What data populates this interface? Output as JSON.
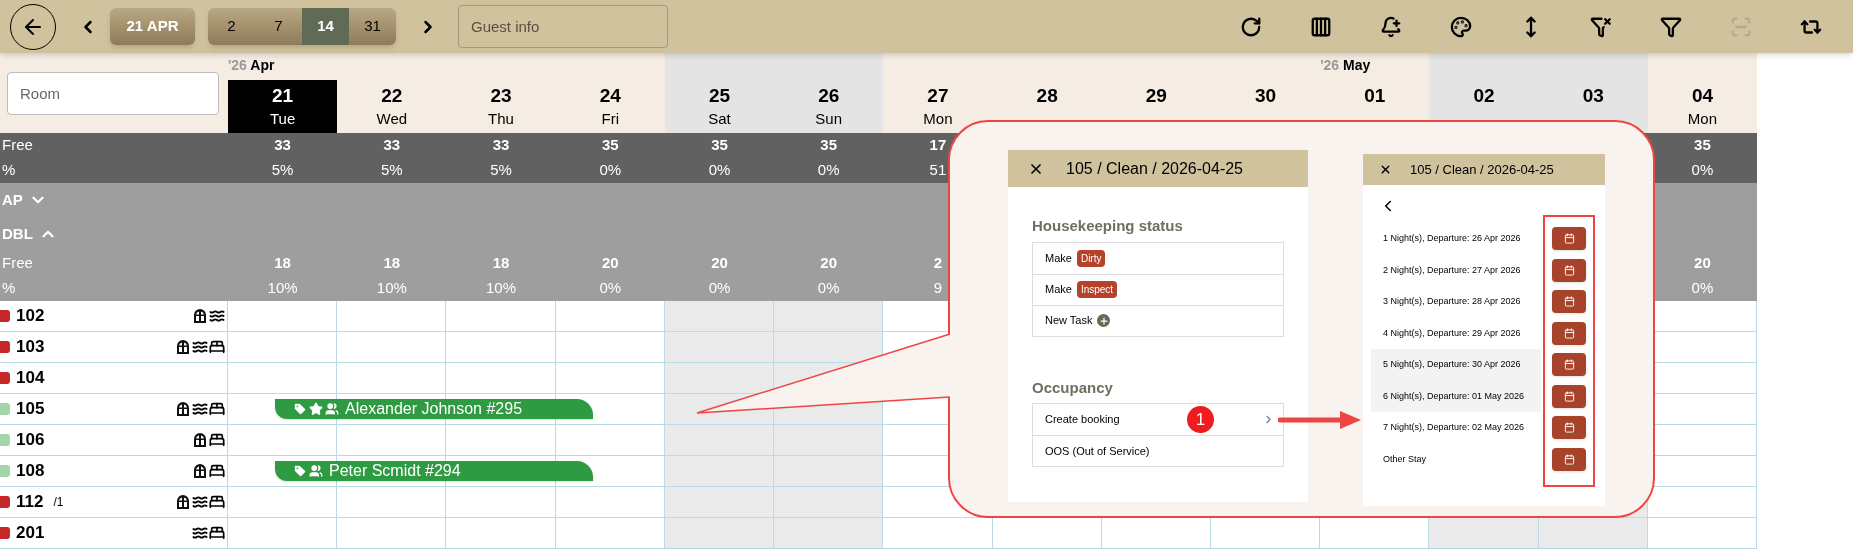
{
  "toolbar": {
    "current_date": "21 APR",
    "ranges": [
      {
        "label": "2",
        "selected": false
      },
      {
        "label": "7",
        "selected": false
      },
      {
        "label": "14",
        "selected": true
      },
      {
        "label": "31",
        "selected": false
      }
    ],
    "search": {
      "placeholder": "Guest info"
    },
    "tools": [
      {
        "kind": "refresh",
        "disabled": false
      },
      {
        "kind": "columns",
        "disabled": false
      },
      {
        "kind": "bell",
        "disabled": false
      },
      {
        "kind": "palette",
        "disabled": false
      },
      {
        "kind": "height",
        "disabled": false
      },
      {
        "kind": "filter-off",
        "disabled": false
      },
      {
        "kind": "filter",
        "disabled": false
      },
      {
        "kind": "focus",
        "disabled": true
      },
      {
        "kind": "swap",
        "disabled": false
      }
    ]
  },
  "room_filter": {
    "placeholder": "Room"
  },
  "days": [
    {
      "day": "21",
      "weekday": "Tue",
      "weekend": false,
      "today": true,
      "year": "'26",
      "month": "Apr"
    },
    {
      "day": "22",
      "weekday": "Wed",
      "weekend": false,
      "today": false
    },
    {
      "day": "23",
      "weekday": "Thu",
      "weekend": false,
      "today": false
    },
    {
      "day": "24",
      "weekday": "Fri",
      "weekend": false,
      "today": false
    },
    {
      "day": "25",
      "weekday": "Sat",
      "weekend": true,
      "today": false
    },
    {
      "day": "26",
      "weekday": "Sun",
      "weekend": true,
      "today": false
    },
    {
      "day": "27",
      "weekday": "Mon",
      "weekend": false,
      "today": false
    },
    {
      "day": "28",
      "weekend": false,
      "today": false
    },
    {
      "day": "29",
      "weekend": false,
      "today": false
    },
    {
      "day": "30",
      "weekend": false,
      "today": false
    },
    {
      "day": "01",
      "weekend": false,
      "today": false,
      "year": "'26",
      "month": "May"
    },
    {
      "day": "02",
      "weekend": true,
      "today": false
    },
    {
      "day": "03",
      "weekend": true,
      "today": false
    },
    {
      "day": "04",
      "weekday": "Mon",
      "weekend": false,
      "today": false
    }
  ],
  "totals": [
    {
      "label": "Free",
      "values": [
        "33",
        "33",
        "33",
        "35",
        "35",
        "35",
        "17"
      ],
      "last_value": "35"
    },
    {
      "label": "%",
      "values": [
        "5%",
        "5%",
        "5%",
        "0%",
        "0%",
        "0%",
        "51"
      ],
      "last_value": "0%"
    }
  ],
  "groups": [
    {
      "name": "AP",
      "expanded": false
    },
    {
      "name": "DBL",
      "expanded": true,
      "rows": [
        {
          "label": "Free",
          "values": [
            "18",
            "18",
            "18",
            "20",
            "20",
            "20",
            "2"
          ],
          "last_value": "20"
        },
        {
          "label": "%",
          "values": [
            "10%",
            "10%",
            "10%",
            "0%",
            "0%",
            "0%",
            "9"
          ],
          "last_value": "0%"
        }
      ]
    }
  ],
  "rooms": [
    {
      "number": "102",
      "color": "#c62828",
      "features": [
        {
          "kind": "window"
        },
        {
          "kind": "waves"
        }
      ]
    },
    {
      "number": "103",
      "color": "#c62828",
      "features": [
        {
          "kind": "window"
        },
        {
          "kind": "waves"
        },
        {
          "kind": "bed"
        }
      ]
    },
    {
      "number": "104",
      "color": "#c62828"
    },
    {
      "number": "105",
      "color": "#a5d6a7",
      "features": [
        {
          "kind": "window"
        },
        {
          "kind": "waves"
        },
        {
          "kind": "bed"
        }
      ],
      "booking": {
        "label": "Alexander Johnson #295",
        "icons": [
          {
            "kind": "tag"
          },
          {
            "kind": "star"
          },
          {
            "kind": "people"
          }
        ]
      }
    },
    {
      "number": "106",
      "color": "#a5d6a7",
      "features": [
        {
          "kind": "window"
        },
        {
          "kind": "bed"
        }
      ]
    },
    {
      "number": "108",
      "color": "#a5d6a7",
      "features": [
        {
          "kind": "window"
        },
        {
          "kind": "bed"
        }
      ],
      "booking": {
        "label": "Peter Scmidt #294",
        "icons": [
          {
            "kind": "tag"
          },
          {
            "kind": "people"
          }
        ]
      }
    },
    {
      "number": "112",
      "suffix": "/1",
      "color": "#c62828",
      "features": [
        {
          "kind": "window"
        },
        {
          "kind": "waves"
        },
        {
          "kind": "bed"
        }
      ]
    },
    {
      "number": "201",
      "color": "#c62828",
      "features": [
        {
          "kind": "waves"
        },
        {
          "kind": "bed"
        }
      ]
    }
  ],
  "callout": {
    "left_panel": {
      "title": "105 / Clean / 2026-04-25",
      "sections": [
        {
          "heading": "Housekeeping status",
          "items": [
            {
              "kind": "status",
              "text": "Make",
              "badge": "Dirty"
            },
            {
              "kind": "status",
              "text": "Make",
              "badge": "Inspect"
            },
            {
              "kind": "add",
              "text": "New Task"
            }
          ]
        },
        {
          "heading": "Occupancy",
          "items": [
            {
              "kind": "link",
              "text": "Create booking",
              "marker": "1"
            },
            {
              "kind": "plain",
              "text": "OOS (Out of Service)"
            }
          ]
        }
      ]
    },
    "right_panel": {
      "title": "105 / Clean / 2026-04-25",
      "options": [
        {
          "text": "1 Night(s), Departure: 26 Apr 2026",
          "highlighted": false
        },
        {
          "text": "2 Night(s), Departure: 27 Apr 2026",
          "highlighted": false
        },
        {
          "text": "3 Night(s), Departure: 28 Apr 2026",
          "highlighted": false
        },
        {
          "text": "4 Night(s), Departure: 29 Apr 2026",
          "highlighted": false
        },
        {
          "text": "5 Night(s), Departure: 30 Apr 2026",
          "highlighted": true
        },
        {
          "text": "6 Night(s), Departure: 01 May 2026",
          "highlighted": true
        },
        {
          "text": "7 Night(s), Departure: 02 May 2026",
          "highlighted": false
        },
        {
          "text": "Other Stay",
          "highlighted": false
        }
      ]
    }
  }
}
